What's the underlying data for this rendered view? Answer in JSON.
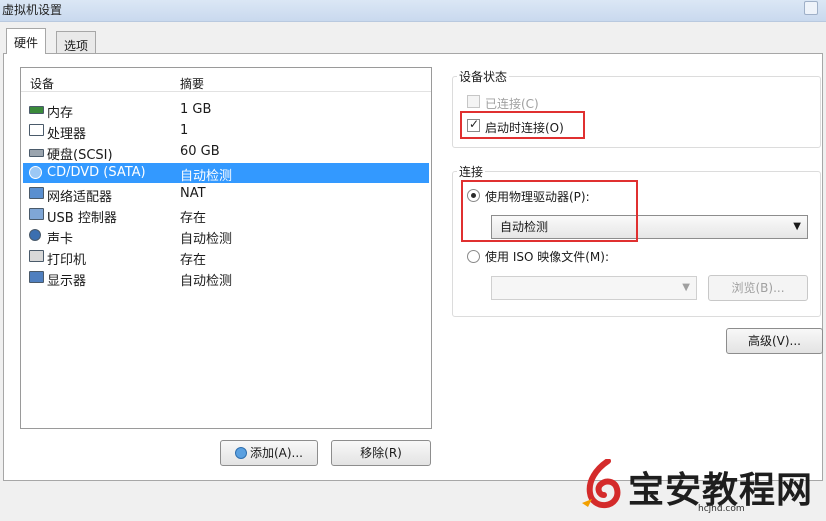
{
  "window": {
    "title": "虚拟机设置"
  },
  "tabs": [
    {
      "label": "硬件",
      "active": true
    },
    {
      "label": "选项",
      "active": false
    }
  ],
  "device_list": {
    "columns": {
      "device": "设备",
      "summary": "摘要"
    },
    "rows": [
      {
        "icon": "memory-icon",
        "name": "内存",
        "summary": "1 GB",
        "selected": false
      },
      {
        "icon": "processor-icon",
        "name": "处理器",
        "summary": "1",
        "selected": false
      },
      {
        "icon": "harddisk-icon",
        "name": "硬盘(SCSI)",
        "summary": "60 GB",
        "selected": false
      },
      {
        "icon": "cd-dvd-icon",
        "name": "CD/DVD (SATA)",
        "summary": "自动检测",
        "selected": true
      },
      {
        "icon": "network-adapter-icon",
        "name": "网络适配器",
        "summary": "NAT",
        "selected": false
      },
      {
        "icon": "usb-controller-icon",
        "name": "USB 控制器",
        "summary": "存在",
        "selected": false
      },
      {
        "icon": "sound-card-icon",
        "name": "声卡",
        "summary": "自动检测",
        "selected": false
      },
      {
        "icon": "printer-icon",
        "name": "打印机",
        "summary": "存在",
        "selected": false
      },
      {
        "icon": "display-icon",
        "name": "显示器",
        "summary": "自动检测",
        "selected": false
      }
    ]
  },
  "buttons": {
    "add": "添加(A)...",
    "remove": "移除(R)",
    "browse": "浏览(B)...",
    "advanced": "高级(V)..."
  },
  "device_status": {
    "title": "设备状态",
    "connected": {
      "label": "已连接(C)",
      "checked": false,
      "enabled": false
    },
    "connect_at_power_on": {
      "label": "启动时连接(O)",
      "checked": true,
      "enabled": true
    }
  },
  "connection": {
    "title": "连接",
    "use_physical_drive": {
      "label": "使用物理驱动器(P):",
      "selected": true
    },
    "physical_drive_value": "自动检测",
    "use_iso_image": {
      "label": "使用 ISO 映像文件(M):",
      "selected": false
    },
    "iso_path_value": ""
  },
  "watermark": {
    "text": "宝安教程网",
    "url": "hcjhd.com"
  },
  "colors": {
    "selection": "#3399ff",
    "highlight_box": "#e03030",
    "logo_red": "#d42b2b"
  }
}
